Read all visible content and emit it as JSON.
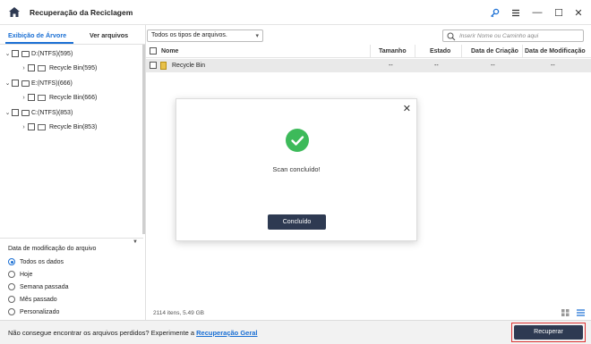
{
  "window": {
    "title": "Recuperação da Reciclagem",
    "controls": {
      "key_icon": "key-icon",
      "menu_icon": "menu-icon",
      "minimize": "—",
      "maximize": "☐",
      "close": "✕"
    }
  },
  "tabs": [
    {
      "label": "Exibição de Árvore",
      "active": true
    },
    {
      "label": "Ver arquivos",
      "active": false
    }
  ],
  "filter": {
    "value": "Todos os tipos de arquivos."
  },
  "search": {
    "placeholder": "Inserir Nome ou Caminho aqui"
  },
  "tree": [
    {
      "label": "D:(NTFS)(595)",
      "child": "Recycle Bin(595)"
    },
    {
      "label": "E:(NTFS)(666)",
      "child": "Recycle Bin(666)"
    },
    {
      "label": "C:(NTFS)(853)",
      "child": "Recycle Bin(853)"
    }
  ],
  "date_filter": {
    "title": "Data de modificação do arquivo",
    "options": [
      "Todos os dados",
      "Hoje",
      "Semana passada",
      "Mês passado",
      "Personalizado"
    ],
    "selected_index": 0
  },
  "list": {
    "columns": [
      "Nome",
      "Tamanho",
      "Estado",
      "Data de Criação",
      "Data de Modificação"
    ],
    "rows": [
      {
        "name": "Recycle Bin",
        "size": "--",
        "state": "--",
        "created": "--",
        "modified": "--"
      }
    ],
    "footer": "2114 itens, 5.49 GB"
  },
  "bottom": {
    "prompt": "Não consegue encontrar os arquivos perdidos? Experimente a",
    "link": "Recuperação Geral",
    "recover_button": "Recuperar"
  },
  "modal": {
    "message": "Scan concluído!",
    "button": "Concluído",
    "close": "✕"
  },
  "colors": {
    "accent": "#1a6fd4",
    "button_dark": "#2e3a52",
    "success": "#3dba5a",
    "highlight": "#dd3333"
  }
}
